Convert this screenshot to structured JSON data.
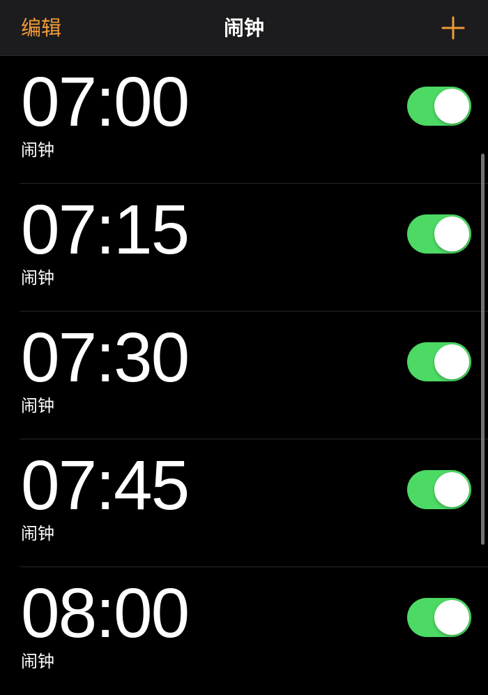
{
  "nav": {
    "edit_label": "编辑",
    "title": "闹钟",
    "add_icon": "plus-icon"
  },
  "alarms": [
    {
      "time": "07:00",
      "label": "闹钟",
      "enabled": true
    },
    {
      "time": "07:15",
      "label": "闹钟",
      "enabled": true
    },
    {
      "time": "07:30",
      "label": "闹钟",
      "enabled": true
    },
    {
      "time": "07:45",
      "label": "闹钟",
      "enabled": true
    },
    {
      "time": "08:00",
      "label": "闹钟",
      "enabled": true
    }
  ],
  "colors": {
    "accent": "#f09a37",
    "toggle_on": "#4cd964",
    "background": "#000000",
    "navbar": "#1c1c1e"
  }
}
